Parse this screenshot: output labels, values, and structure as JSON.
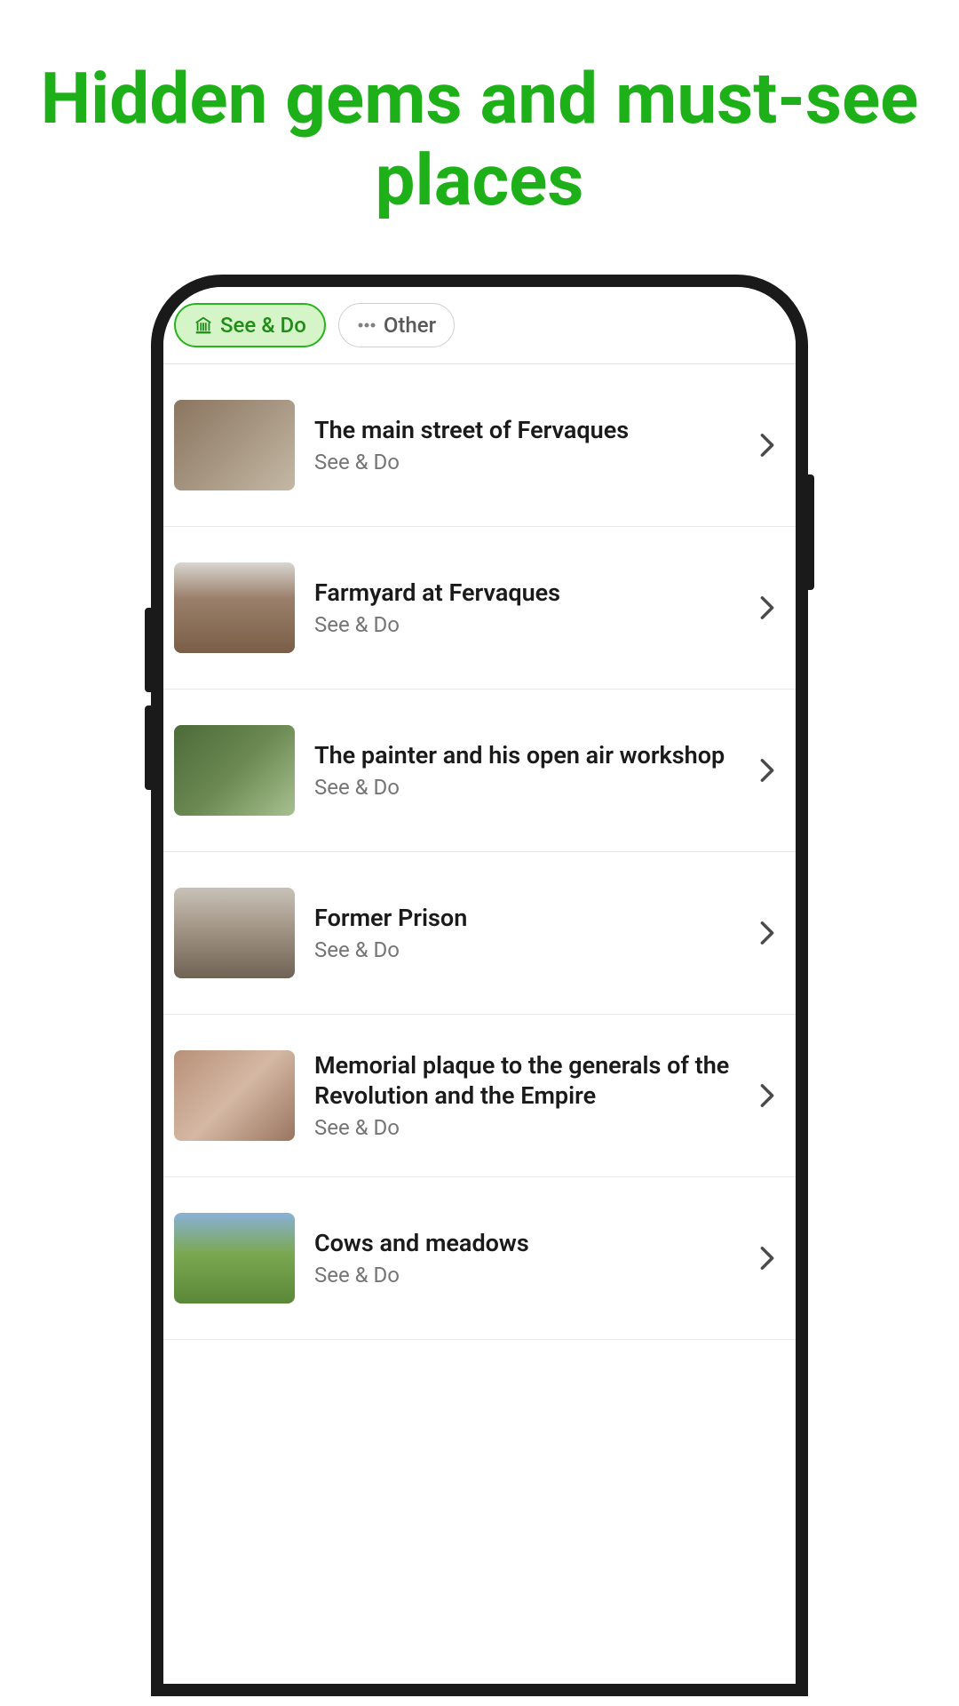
{
  "headline": "Hidden gems and must-see places",
  "filters": {
    "active": {
      "label": "See & Do",
      "icon": "museum-icon"
    },
    "other": {
      "label": "Other",
      "icon": "ellipsis-icon"
    }
  },
  "items": [
    {
      "title": "The main street of Fervaques",
      "category": "See & Do"
    },
    {
      "title": "Farmyard at Fervaques",
      "category": "See & Do"
    },
    {
      "title": "The painter and his open air workshop",
      "category": "See & Do"
    },
    {
      "title": "Former Prison",
      "category": "See & Do"
    },
    {
      "title": "Memorial plaque to the generals of the Revolution and the Empire",
      "category": "See & Do"
    },
    {
      "title": "Cows and meadows",
      "category": "See & Do"
    }
  ]
}
